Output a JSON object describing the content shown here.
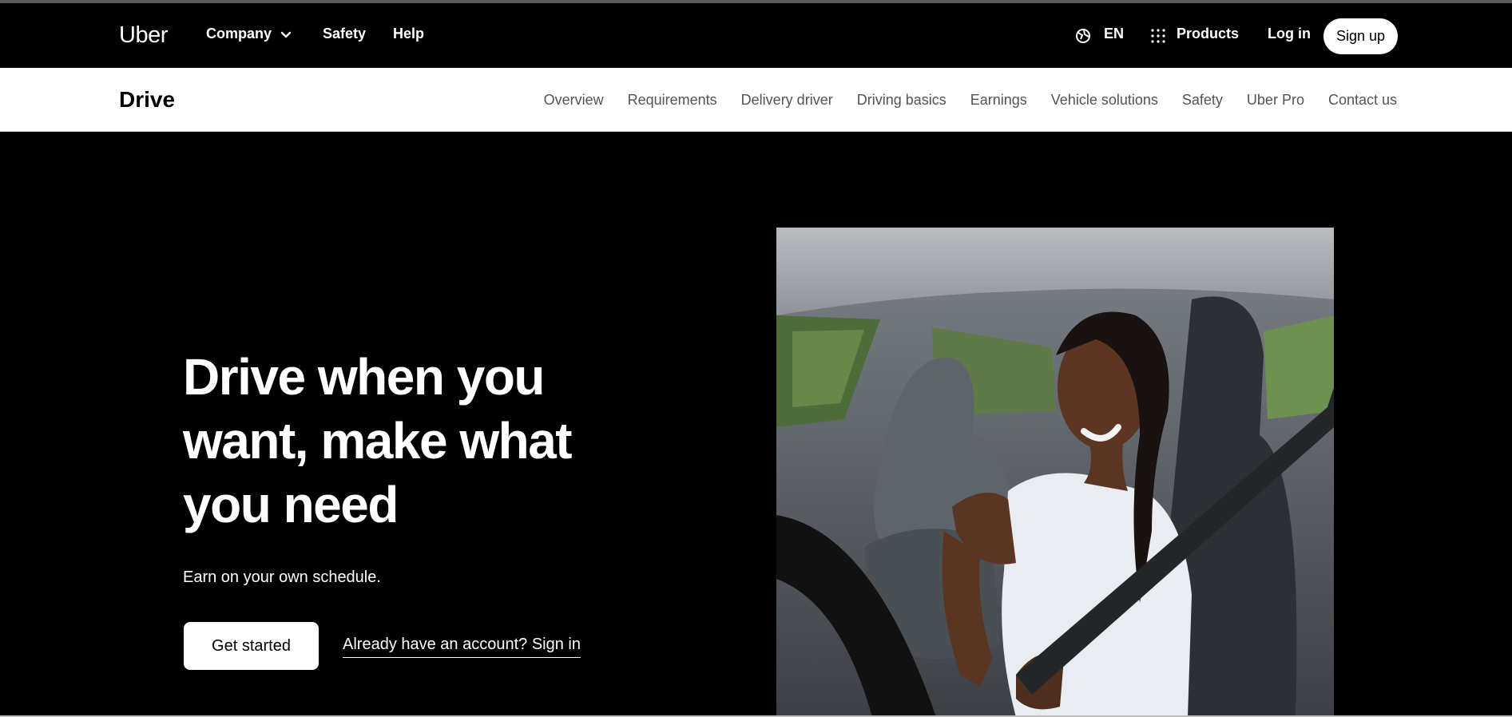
{
  "topnav": {
    "logo": "Uber",
    "company": "Company",
    "safety": "Safety",
    "help": "Help",
    "language": "EN",
    "products": "Products",
    "login": "Log in",
    "signup": "Sign up"
  },
  "subnav": {
    "title": "Drive",
    "links": [
      "Overview",
      "Requirements",
      "Delivery driver",
      "Driving basics",
      "Earnings",
      "Vehicle solutions",
      "Safety",
      "Uber Pro",
      "Contact us"
    ]
  },
  "hero": {
    "headline": "Drive when you want, make what you need",
    "subheadline": "Earn on your own schedule.",
    "cta": "Get started",
    "signin": "Already have an account? Sign in"
  },
  "icons": {
    "globe": "globe-icon",
    "products": "grid-dots-icon",
    "company_dropdown": "chevron-down-icon"
  },
  "colors": {
    "background": "#000000",
    "subnav_background": "#ffffff",
    "subnav_link": "#545454"
  }
}
